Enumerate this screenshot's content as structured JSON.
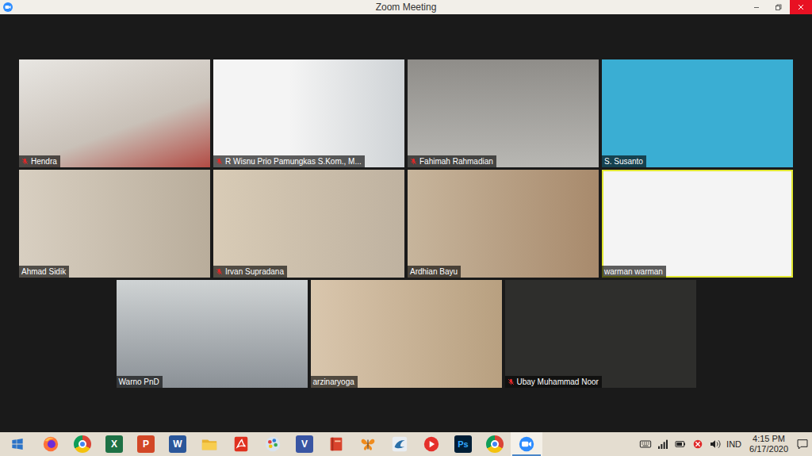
{
  "window": {
    "title": "Zoom Meeting"
  },
  "participants": [
    {
      "name": "Hendra",
      "muted": true,
      "speaking": false
    },
    {
      "name": "R Wisnu Prio Pamungkas S.Kom., M...",
      "muted": true,
      "speaking": false
    },
    {
      "name": "Fahimah Rahmadian",
      "muted": true,
      "speaking": false
    },
    {
      "name": "S. Susanto",
      "muted": false,
      "speaking": false
    },
    {
      "name": "Ahmad Sidik",
      "muted": false,
      "speaking": false
    },
    {
      "name": "Irvan Supradana",
      "muted": true,
      "speaking": false
    },
    {
      "name": "Ardhian Bayu",
      "muted": false,
      "speaking": false
    },
    {
      "name": "warman warman",
      "muted": false,
      "speaking": true
    },
    {
      "name": "Warno PnD",
      "muted": false,
      "speaking": false
    },
    {
      "name": "arzinaryoga",
      "muted": false,
      "speaking": false
    },
    {
      "name": "Ubay Muhammad Noor",
      "muted": true,
      "speaking": false
    }
  ],
  "taskbar": {
    "apps": [
      {
        "kind": "firefox",
        "active": false
      },
      {
        "kind": "chrome",
        "active": false
      },
      {
        "kind": "excel",
        "glyph": "X",
        "active": false
      },
      {
        "kind": "powerpoint",
        "glyph": "P",
        "active": false
      },
      {
        "kind": "word",
        "glyph": "W",
        "active": false
      },
      {
        "kind": "folder",
        "active": false
      },
      {
        "kind": "pdf",
        "active": false
      },
      {
        "kind": "paint",
        "active": false
      },
      {
        "kind": "visio",
        "glyph": "V",
        "active": false
      },
      {
        "kind": "book",
        "active": false
      },
      {
        "kind": "butterfly",
        "active": false
      },
      {
        "kind": "workbench",
        "active": false
      },
      {
        "kind": "player",
        "active": false
      },
      {
        "kind": "photoshop",
        "glyph": "Ps",
        "active": false
      },
      {
        "kind": "chrome",
        "active": false
      },
      {
        "kind": "zoom",
        "active": true
      }
    ],
    "tray": {
      "language": "IND",
      "time": "4:15 PM",
      "date": "6/17/2020"
    }
  }
}
